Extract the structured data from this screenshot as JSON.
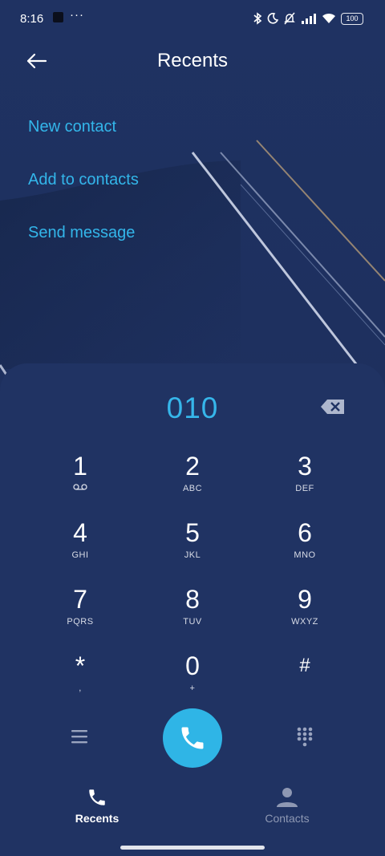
{
  "status_bar": {
    "time": "8:16",
    "more": "···",
    "battery": "100"
  },
  "header": {
    "title": "Recents"
  },
  "actions": {
    "new_contact": "New contact",
    "add_to_contacts": "Add to contacts",
    "send_message": "Send message"
  },
  "dialer": {
    "number": "010",
    "keys": [
      {
        "digit": "1",
        "letters": ""
      },
      {
        "digit": "2",
        "letters": "ABC"
      },
      {
        "digit": "3",
        "letters": "DEF"
      },
      {
        "digit": "4",
        "letters": "GHI"
      },
      {
        "digit": "5",
        "letters": "JKL"
      },
      {
        "digit": "6",
        "letters": "MNO"
      },
      {
        "digit": "7",
        "letters": "PQRS"
      },
      {
        "digit": "8",
        "letters": "TUV"
      },
      {
        "digit": "9",
        "letters": "WXYZ"
      },
      {
        "digit": "*",
        "letters": ","
      },
      {
        "digit": "0",
        "letters": "+"
      },
      {
        "digit": "#",
        "letters": ""
      }
    ]
  },
  "tabs": {
    "recents": "Recents",
    "contacts": "Contacts"
  },
  "colors": {
    "background": "#1f3262",
    "accent": "#33b6ea",
    "call_button": "#2fb5e6",
    "inactive_tab": "#8e98b3"
  },
  "icons": {
    "back": "arrow-left-icon",
    "backspace": "backspace-icon",
    "voicemail": "voicemail-icon",
    "menu": "menu-icon",
    "call": "phone-icon",
    "keypad": "keypad-grid-icon",
    "recents_tab": "phone-icon",
    "contacts_tab": "person-icon"
  }
}
